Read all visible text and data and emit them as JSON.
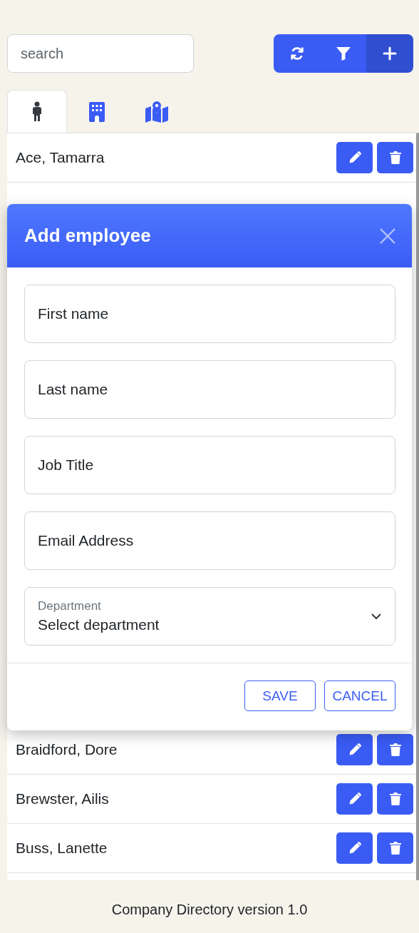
{
  "search": {
    "placeholder": "search"
  },
  "toolbar": [
    {
      "kind": "refresh"
    },
    {
      "kind": "filter"
    },
    {
      "kind": "add"
    }
  ],
  "tabs": [
    {
      "kind": "person",
      "selected": true
    },
    {
      "kind": "building",
      "selected": false
    },
    {
      "kind": "map",
      "selected": false
    }
  ],
  "rows_top": [
    {
      "name": "Ace, Tamarra"
    }
  ],
  "rows_bottom": [
    {
      "name": "Braidford, Dore"
    },
    {
      "name": "Brewster, Ailis"
    },
    {
      "name": "Buss, Lanette"
    }
  ],
  "modal": {
    "title": "Add employee",
    "fields": [
      {
        "kind": "input",
        "placeholder": "First name"
      },
      {
        "kind": "input",
        "placeholder": "Last name"
      },
      {
        "kind": "input",
        "placeholder": "Job Title"
      },
      {
        "kind": "input",
        "placeholder": "Email Address"
      },
      {
        "kind": "select",
        "label": "Department",
        "value": "Select department"
      }
    ],
    "buttons": [
      "SAVE",
      "CANCEL"
    ]
  },
  "footer": "Company Directory version 1.0"
}
